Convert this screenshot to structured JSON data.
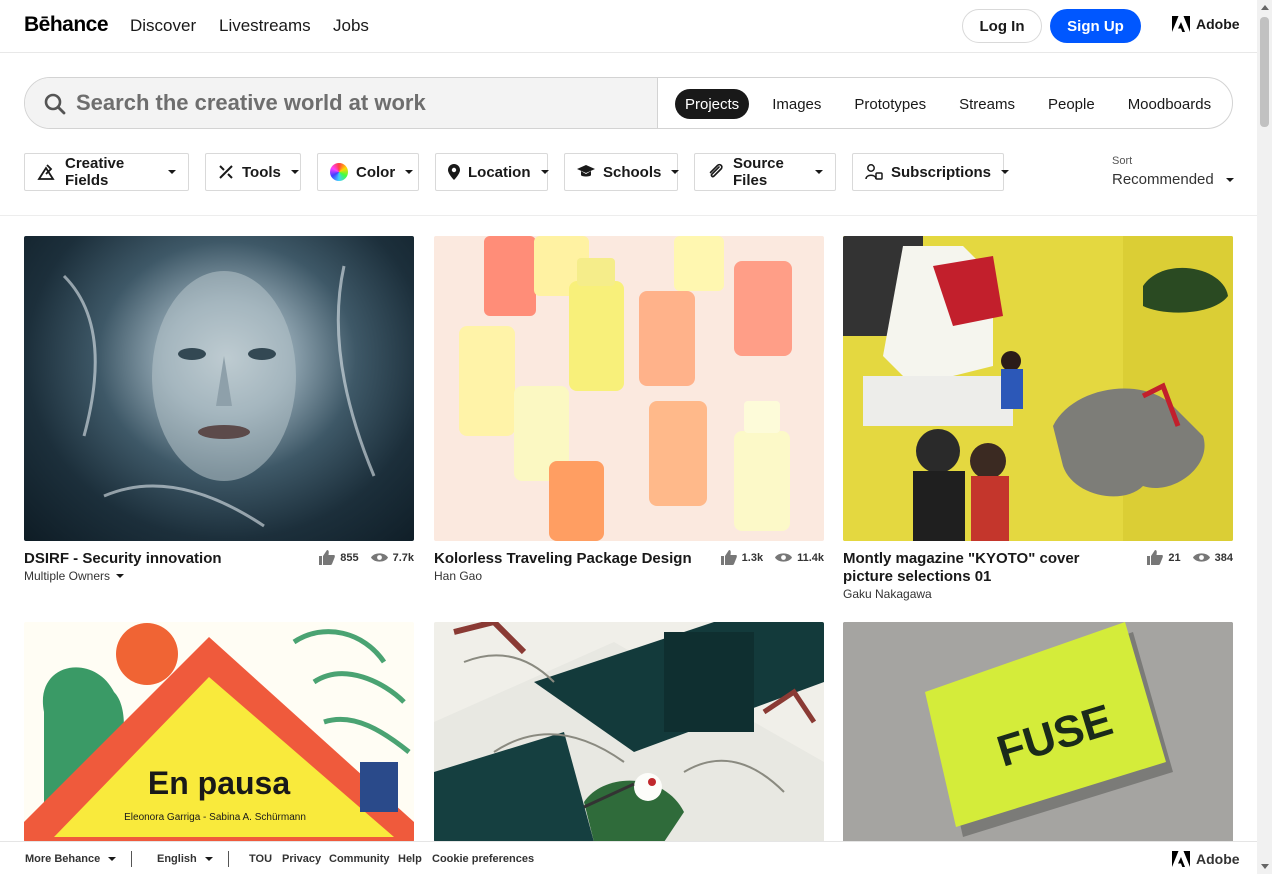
{
  "header": {
    "logo": "Bēhance",
    "nav": [
      "Discover",
      "Livestreams",
      "Jobs"
    ],
    "login": "Log In",
    "signup": "Sign Up",
    "adobe": "Adobe"
  },
  "search": {
    "placeholder": "Search the creative world at work",
    "tabs": [
      "Projects",
      "Images",
      "Prototypes",
      "Streams",
      "People",
      "Moodboards"
    ],
    "active_tab": "Projects"
  },
  "filters": [
    "Creative Fields",
    "Tools",
    "Color",
    "Location",
    "Schools",
    "Source Files",
    "Subscriptions"
  ],
  "sort": {
    "label": "Sort",
    "value": "Recommended"
  },
  "projects": [
    {
      "title": "DSIRF - Security innovation",
      "owner": "Multiple Owners",
      "likes": "855",
      "views": "7.7k"
    },
    {
      "title": "Kolorless Traveling Package Design",
      "owner": "Han Gao",
      "likes": "1.3k",
      "views": "11.4k"
    },
    {
      "title": "Montly magazine \"KYOTO\" cover picture selections 01",
      "owner": "Gaku Nakagawa",
      "likes": "21",
      "views": "384"
    },
    {
      "cover_text": "En pausa",
      "cover_subtitle": "Eleonora Garriga - Sabina A. Schürmann"
    },
    {
      "cover_text": ""
    },
    {
      "cover_text": "FUSE"
    }
  ],
  "footer": {
    "more": "More Behance",
    "language": "English",
    "links": [
      "TOU",
      "Privacy",
      "Community",
      "Help",
      "Cookie preferences"
    ],
    "adobe": "Adobe"
  },
  "colors": {
    "accent": "#0057ff",
    "text": "#191919",
    "active_tab_bg": "#191919"
  }
}
